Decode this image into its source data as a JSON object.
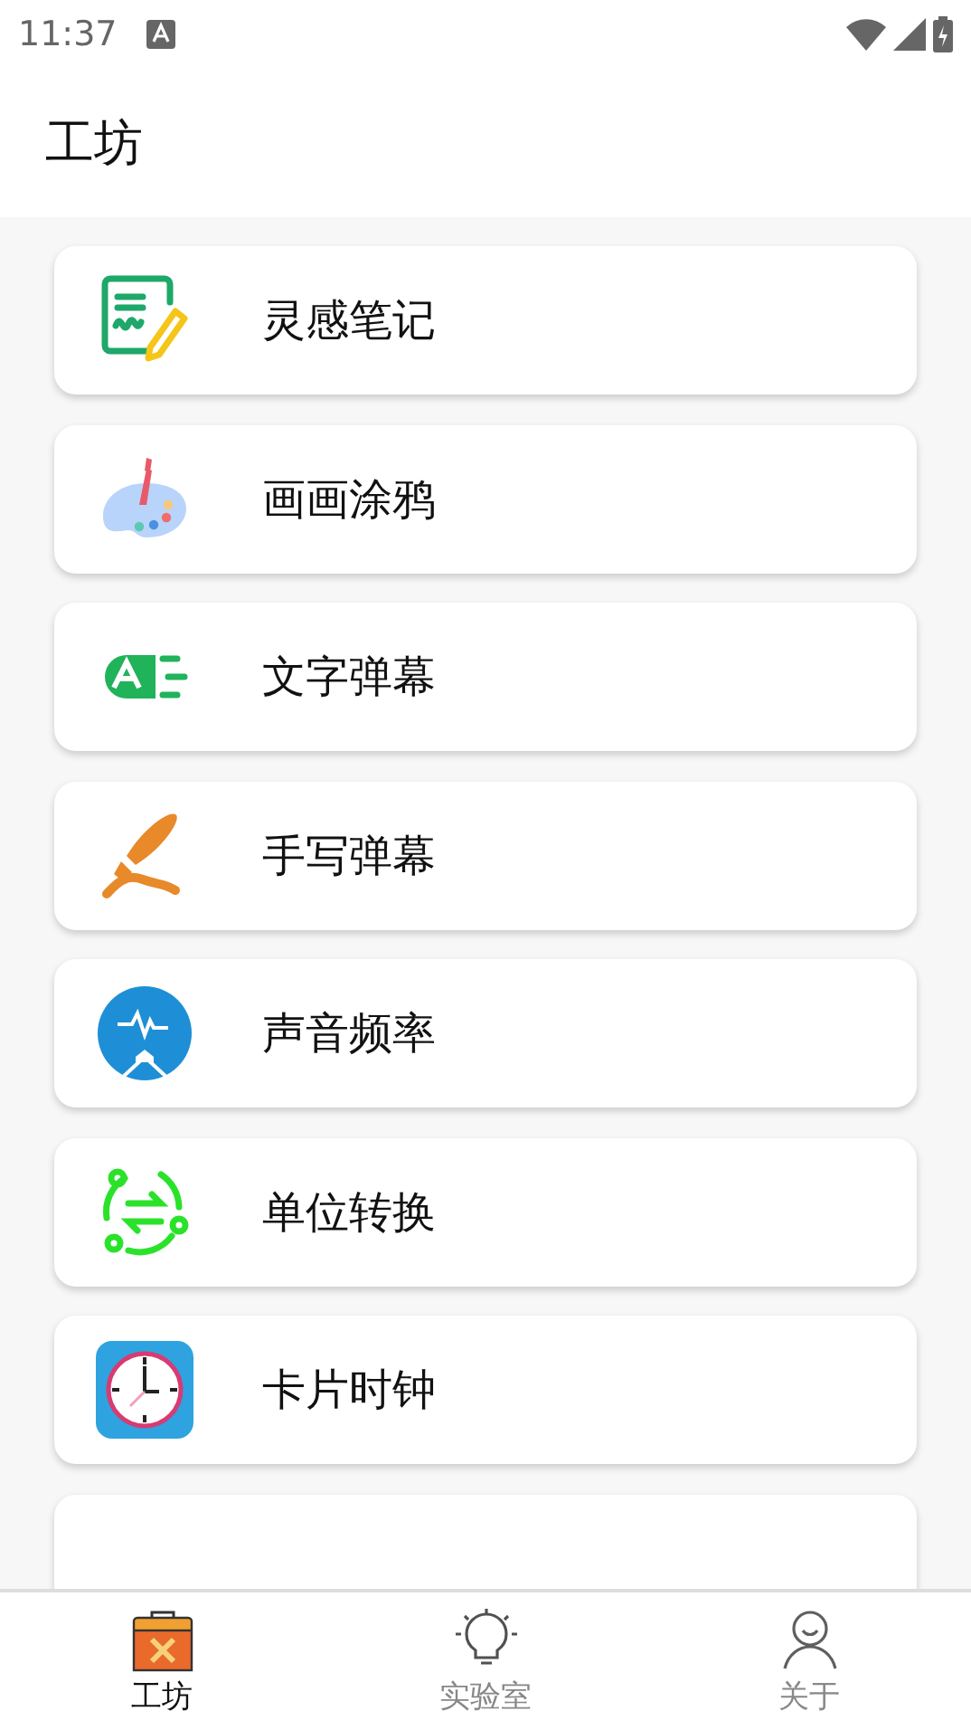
{
  "status_bar": {
    "time": "11:37"
  },
  "app_bar": {
    "title": "工坊"
  },
  "tools": [
    {
      "label": "灵感笔记",
      "kind": "note"
    },
    {
      "label": "画画涂鸦",
      "kind": "palette"
    },
    {
      "label": "文字弹幕",
      "kind": "text"
    },
    {
      "label": "手写弹幕",
      "kind": "brush"
    },
    {
      "label": "声音频率",
      "kind": "sound"
    },
    {
      "label": "单位转换",
      "kind": "convert"
    },
    {
      "label": "卡片时钟",
      "kind": "clock"
    }
  ],
  "bottom_nav": [
    {
      "label": "工坊",
      "kind": "toolbox",
      "selected": true
    },
    {
      "label": "实验室",
      "kind": "bulb",
      "selected": false
    },
    {
      "label": "关于",
      "kind": "person",
      "selected": false
    }
  ]
}
